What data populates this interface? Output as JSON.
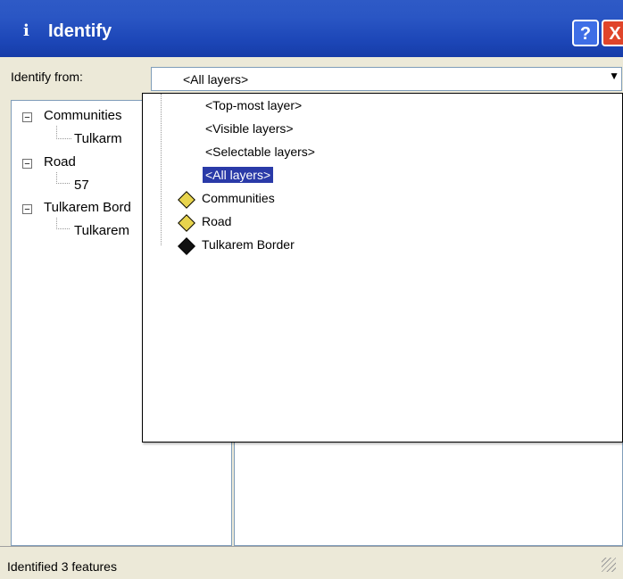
{
  "window": {
    "title": "Identify",
    "title_icon": "i"
  },
  "controls": {
    "help": "?",
    "close": "X"
  },
  "identify_from": {
    "label": "Identify from:",
    "value": "<All layers>"
  },
  "tree": {
    "items": [
      {
        "label": "Communities",
        "child": "Tulkarm"
      },
      {
        "label": "Road",
        "child": "57"
      },
      {
        "label": "Tulkarem Bord",
        "child": "Tulkarem"
      }
    ]
  },
  "dropdown": {
    "options": [
      {
        "label": "<Top-most layer>"
      },
      {
        "label": "<Visible layers>"
      },
      {
        "label": "<Selectable layers>"
      },
      {
        "label": "<All layers>",
        "selected": true
      },
      {
        "label": "Communities",
        "icon": "layer-diamond-yellow-icon"
      },
      {
        "label": "Road",
        "icon": "layer-diamond-yellow-icon"
      },
      {
        "label": "Tulkarem Border",
        "icon": "layer-diamond-black-icon"
      }
    ]
  },
  "status": {
    "text": "Identified 3 features"
  }
}
